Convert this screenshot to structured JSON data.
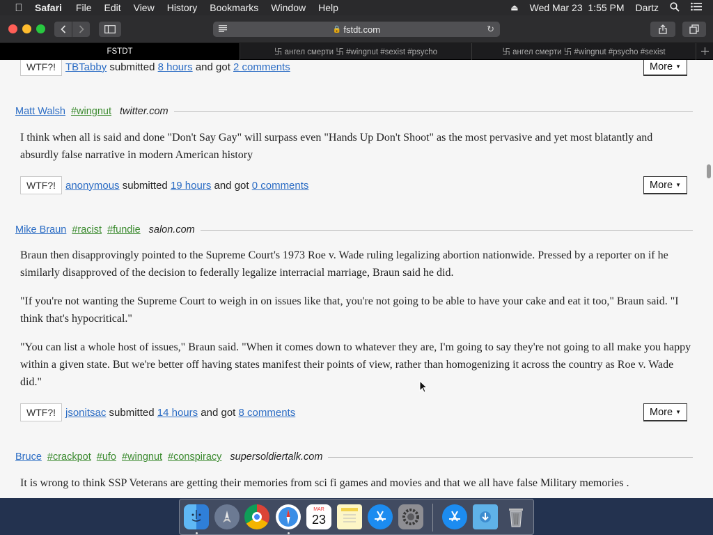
{
  "menubar": {
    "apple_icon": "apple-logo",
    "app_name": "Safari",
    "menus": [
      "File",
      "Edit",
      "View",
      "History",
      "Bookmarks",
      "Window",
      "Help"
    ],
    "datetime": "Wed Mar 23  1:55 PM",
    "user": "Dartz"
  },
  "toolbar": {
    "url": "fstdt.com"
  },
  "tabs": [
    {
      "label": "FSTDT",
      "active": true
    },
    {
      "label": "卐 ангел смерти 卐 #wingnut #sexist #psycho",
      "active": false
    },
    {
      "label": "卐 ангел смерти 卐 #wingnut #psycho #sexist",
      "active": false
    }
  ],
  "posts": [
    {
      "footer": {
        "wtf": "WTF?!",
        "submitter": "TBTabby",
        "submitted_text": "submitted",
        "time": "8 hours",
        "got_text": "and got",
        "comments": "2 comments",
        "more": "More"
      }
    },
    {
      "author": "Matt Walsh",
      "tags": [
        "#wingnut"
      ],
      "source": "twitter.com",
      "paragraphs": [
        "I think when all is said and done \"Don't Say Gay\" will surpass even \"Hands Up Don't Shoot\" as the most pervasive and yet most blatantly and absurdly false narrative in modern American history"
      ],
      "footer": {
        "wtf": "WTF?!",
        "submitter": "anonymous",
        "submitted_text": "submitted",
        "time": "19 hours",
        "got_text": "and got",
        "comments": "0 comments",
        "more": "More"
      }
    },
    {
      "author": "Mike Braun",
      "tags": [
        "#racist",
        "#fundie"
      ],
      "source": "salon.com",
      "paragraphs": [
        "Braun then disapprovingly pointed to the Supreme Court's 1973 Roe v. Wade ruling legalizing abortion nationwide. Pressed by a reporter on if he similarly disapproved of the decision to federally legalize interracial marriage, Braun said he did.",
        "\"If you're not wanting the Supreme Court to weigh in on issues like that, you're not going to be able to have your cake and eat it too,\" Braun said. \"I think that's hypocritical.\"",
        "\"You can list a whole host of issues,\" Braun said. \"When it comes down to whatever they are, I'm going to say they're not going to all make you happy within a given state. But we're better off having states manifest their points of view, rather than homogenizing it across the country as Roe v. Wade did.\""
      ],
      "footer": {
        "wtf": "WTF?!",
        "submitter": "jsonitsac",
        "submitted_text": "submitted",
        "time": "14 hours",
        "got_text": "and got",
        "comments": "8 comments",
        "more": "More"
      }
    },
    {
      "author": "Bruce",
      "tags": [
        "#crackpot",
        "#ufo",
        "#wingnut",
        "#conspiracy"
      ],
      "source": "supersoldiertalk.com",
      "paragraphs": [
        "It is wrong to think SSP Veterans are getting their memories from sci fi games and movies and that we all have false Military memories ."
      ]
    }
  ],
  "dock": {
    "calendar_month": "MAR",
    "calendar_day": "23",
    "apps": [
      "Finder",
      "Launchpad",
      "Chrome",
      "Safari",
      "Calendar",
      "Notes",
      "App Store",
      "System Preferences",
      "App Store",
      "Downloads",
      "Trash"
    ]
  }
}
